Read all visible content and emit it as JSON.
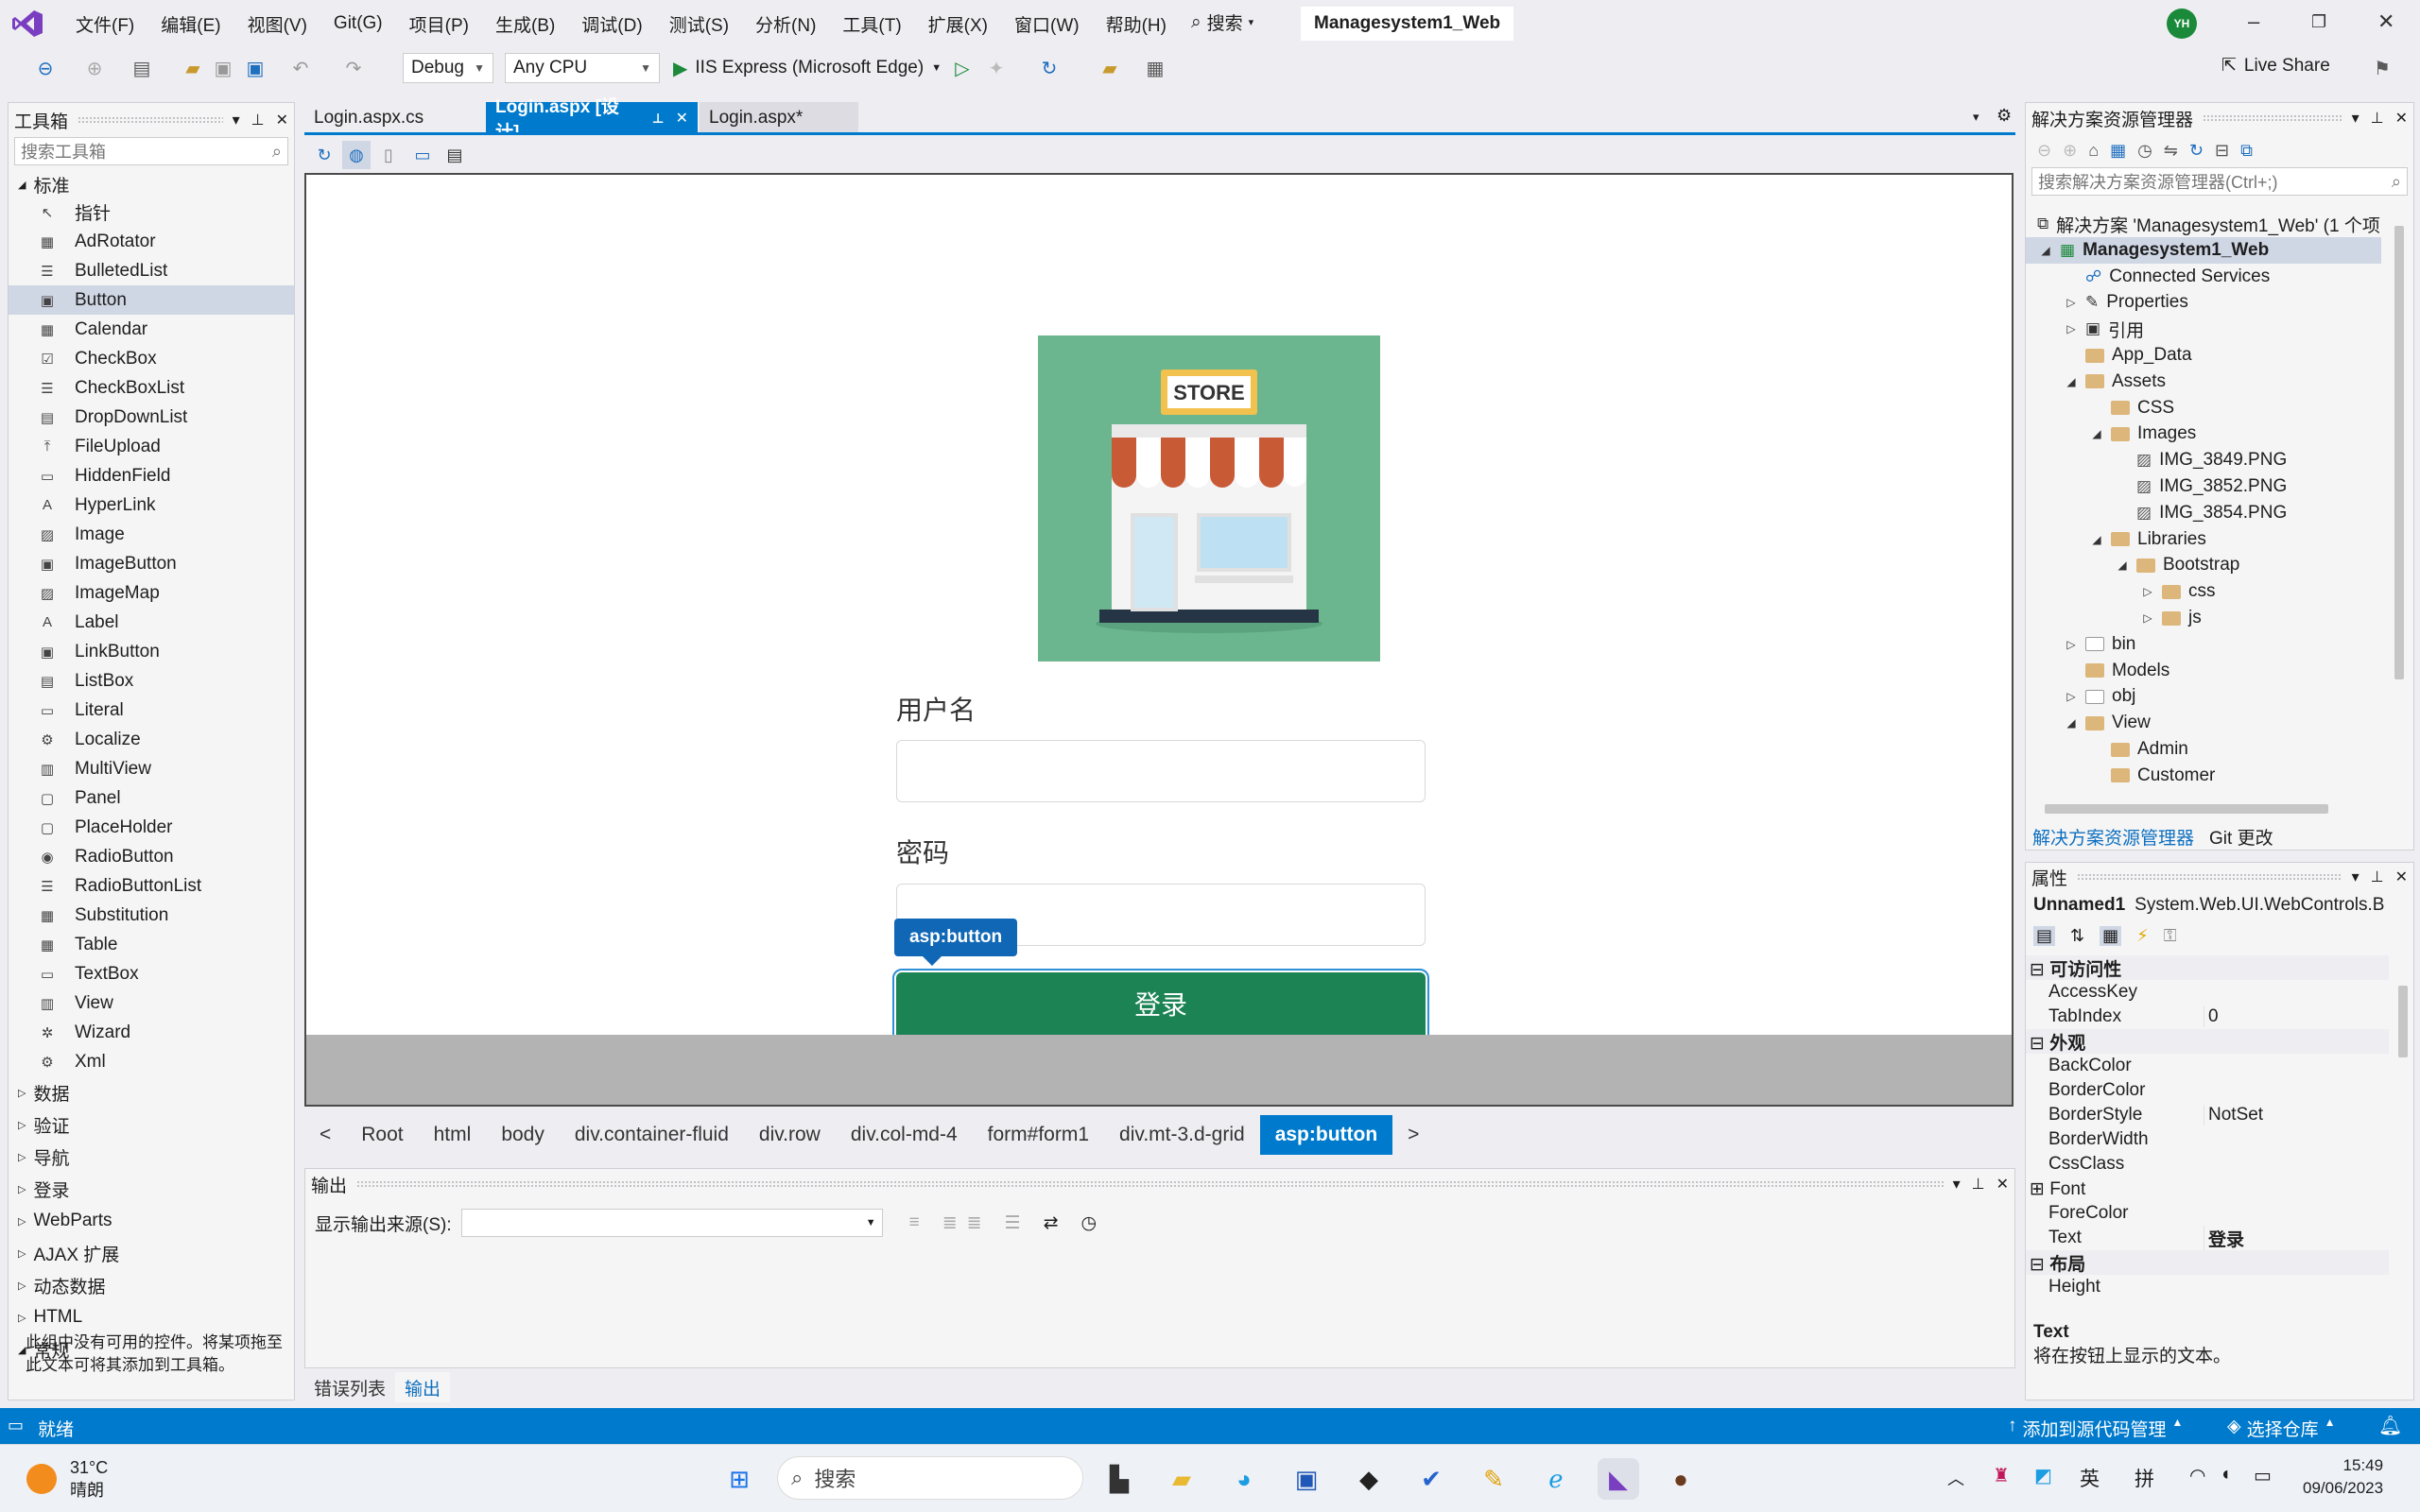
{
  "menubar": {
    "items": [
      "文件(F)",
      "编辑(E)",
      "视图(V)",
      "Git(G)",
      "项目(P)",
      "生成(B)",
      "调试(D)",
      "测试(S)",
      "分析(N)",
      "工具(T)",
      "扩展(X)",
      "窗口(W)",
      "帮助(H)"
    ],
    "search_label": "搜索",
    "solution_name": "Managesystem1_Web",
    "avatar_initials": "YH"
  },
  "toolbar": {
    "config": "Debug",
    "platform": "Any CPU",
    "run_label": "IIS Express (Microsoft Edge)",
    "live_share": "Live Share"
  },
  "toolbox": {
    "title": "工具箱",
    "search_placeholder": "搜索工具箱",
    "standard_group": "标准",
    "items": [
      "指针",
      "AdRotator",
      "BulletedList",
      "Button",
      "Calendar",
      "CheckBox",
      "CheckBoxList",
      "DropDownList",
      "FileUpload",
      "HiddenField",
      "HyperLink",
      "Image",
      "ImageButton",
      "ImageMap",
      "Label",
      "LinkButton",
      "ListBox",
      "Literal",
      "Localize",
      "MultiView",
      "Panel",
      "PlaceHolder",
      "RadioButton",
      "RadioButtonList",
      "Substitution",
      "Table",
      "TextBox",
      "View",
      "Wizard",
      "Xml"
    ],
    "selected": "Button",
    "groups": [
      "数据",
      "验证",
      "导航",
      "登录",
      "WebParts",
      "AJAX 扩展",
      "动态数据",
      "HTML",
      "常规"
    ],
    "note": "此组中没有可用的控件。将某项拖至此文本可将其添加到工具箱。"
  },
  "doc_tabs": [
    "Login.aspx.cs",
    "Login.aspx [设计]",
    "Login.aspx*"
  ],
  "design": {
    "store_sign": "STORE",
    "username_label": "用户名",
    "password_label": "密码",
    "badge": "asp:button",
    "login_button": "登录"
  },
  "breadcrumb": [
    "<",
    "Root",
    "html",
    "body",
    "div.container-fluid",
    "div.row",
    "div.col-md-4",
    "form#form1",
    "div.mt-3.d-grid",
    "asp:button",
    ">"
  ],
  "output": {
    "title": "输出",
    "source_label": "显示输出来源(S):",
    "tabs": [
      "错误列表",
      "输出"
    ]
  },
  "solution_explorer": {
    "title": "解决方案资源管理器",
    "search_placeholder": "搜索解决方案资源管理器(Ctrl+;)",
    "solution_line": "解决方案 'Managesystem1_Web' (1 个项",
    "project": "Managesystem1_Web",
    "nodes": [
      "Connected Services",
      "Properties",
      "引用",
      "App_Data",
      "Assets",
      "CSS",
      "Images",
      "IMG_3849.PNG",
      "IMG_3852.PNG",
      "IMG_3854.PNG",
      "Libraries",
      "Bootstrap",
      "css",
      "js",
      "bin",
      "Models",
      "obj",
      "View",
      "Admin",
      "Customer"
    ],
    "tabs": [
      "解决方案资源管理器",
      "Git 更改"
    ]
  },
  "properties": {
    "title": "属性",
    "object": "Unnamed1",
    "object_type": "System.Web.UI.WebControls.B",
    "rows": [
      {
        "name": "可访问性",
        "value": ""
      },
      {
        "name": "AccessKey",
        "value": ""
      },
      {
        "name": "TabIndex",
        "value": "0"
      },
      {
        "name": "外观",
        "value": ""
      },
      {
        "name": "BackColor",
        "value": ""
      },
      {
        "name": "BorderColor",
        "value": ""
      },
      {
        "name": "BorderStyle",
        "value": "NotSet"
      },
      {
        "name": "BorderWidth",
        "value": ""
      },
      {
        "name": "CssClass",
        "value": ""
      },
      {
        "name": "Font",
        "value": ""
      },
      {
        "name": "ForeColor",
        "value": ""
      },
      {
        "name": "Text",
        "value": "登录"
      },
      {
        "name": "布局",
        "value": ""
      },
      {
        "name": "Height",
        "value": ""
      }
    ],
    "desc_title": "Text",
    "desc_text": "将在按钮上显示的文本。"
  },
  "statusbar": {
    "ready": "就绪",
    "add_source": "添加到源代码管理",
    "select_repo": "选择仓库"
  },
  "taskbar": {
    "weather_temp": "31°C",
    "weather_desc": "晴朗",
    "search_label": "搜索",
    "ime1": "英",
    "ime2": "拼",
    "time": "15:49",
    "date": "09/06/2023"
  },
  "colors": {
    "accent": "#007acc",
    "login_button": "#1c8354",
    "image_bg": "#6bb68f"
  }
}
